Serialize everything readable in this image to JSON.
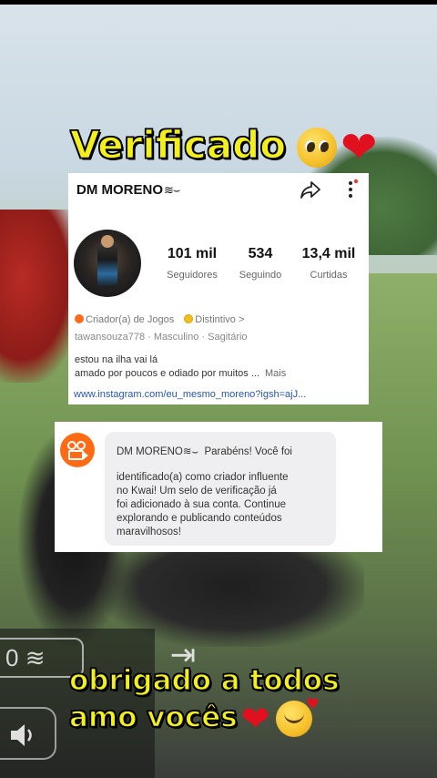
{
  "captions": {
    "top": "Verificado",
    "bottom_line1": "obrigado a todos",
    "bottom_line2": "amo vocês",
    "heart": "❤",
    "emoji_top": "pleading-face",
    "emoji_bottom": "smiling-face-with-hearts"
  },
  "profile": {
    "name": "DM MORENO",
    "name_mark": "≋⌣",
    "stats": [
      {
        "value": "101 mil",
        "label": "Seguidores"
      },
      {
        "value": "534",
        "label": "Seguindo"
      },
      {
        "value": "13,4 mil",
        "label": "Curtidas"
      }
    ],
    "tag_creator": "Criador(a) de Jogos",
    "tag_badge": "Distintivo",
    "tag_badge_arrow": ">",
    "sub_info": "tawansouza778 · Masculino · Sagitário",
    "bio_line1": "estou na ilha vai lá",
    "bio_line2": "amado por poucos e odiado por muitos ...",
    "bio_more": "Mais",
    "link": "www.instagram.com/eu_mesmo_moreno?igsh=ajJ..."
  },
  "message": {
    "sender": "DM MORENO",
    "sender_mark": "≋⌣",
    "line1_tail": "Parabéns! Você foi",
    "line2": "identificado(a) como criador influente",
    "line3": "no Kwai! Um selo de verificação já",
    "line4": "foi adicionado à sua conta. Continue",
    "line5": "explorando e publicando conteúdos",
    "line6": "maravilhosos!"
  },
  "game_hud": {
    "control_left": "0",
    "control_exit": "⇥"
  },
  "colors": {
    "caption_yellow": "#f3ef1d",
    "kwai_orange": "#ff6a14",
    "link_blue": "#2a55a6",
    "heart_red": "#e0101e"
  },
  "icons": [
    "share-icon",
    "more-vertical-icon",
    "kwai-logo-icon",
    "creator-badge-icon",
    "distintivo-badge-icon",
    "sound-icon",
    "exit-icon"
  ]
}
